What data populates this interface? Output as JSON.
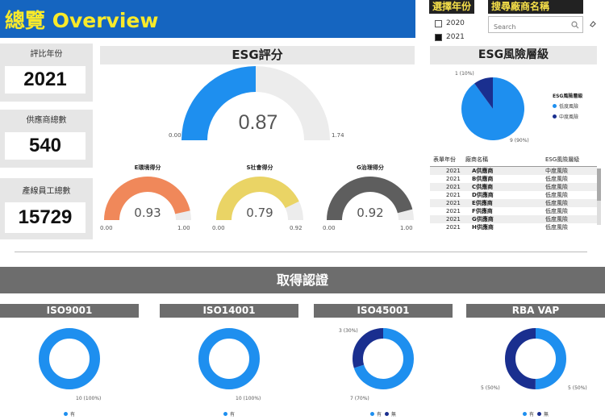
{
  "header": {
    "title": "總覽 Overview"
  },
  "filters": {
    "year_title": "選擇年份",
    "years": [
      {
        "label": "2020",
        "checked": false
      },
      {
        "label": "2021",
        "checked": true
      }
    ],
    "search_title": "搜尋廠商名稱",
    "search_placeholder": "Search"
  },
  "kpis": {
    "year": {
      "label": "評比年份",
      "value": "2021"
    },
    "suppliers": {
      "label": "供應商總數",
      "value": "540"
    },
    "employees": {
      "label": "產線員工總數",
      "value": "15729"
    }
  },
  "esg": {
    "title": "ESG評分",
    "score": "0.87",
    "min": "0.00",
    "max": "1.74",
    "value": 0.87,
    "range": [
      0,
      1.74
    ]
  },
  "sub_scores": [
    {
      "label": "E環境得分",
      "score": "0.93",
      "min": "0.00",
      "max": "1.00",
      "value": 0.93,
      "color": "#f0885a"
    },
    {
      "label": "S社會得分",
      "score": "0.79",
      "min": "0.00",
      "max": "0.92",
      "value": 0.79,
      "range_max": 0.92,
      "color": "#ead465"
    },
    {
      "label": "G治理得分",
      "score": "0.92",
      "min": "0.00",
      "max": "1.00",
      "value": 0.92,
      "color": "#5e5e5e"
    }
  ],
  "risk": {
    "title": "ESG風險層級",
    "legend_title": "ESG風險層級",
    "slices": [
      {
        "name": "低度風險",
        "value": 9,
        "label": "9 (90%)",
        "color": "#1e8fef"
      },
      {
        "name": "中度風險",
        "value": 1,
        "label": "1 (10%)",
        "color": "#1a2f8f"
      }
    ],
    "table": {
      "columns": [
        "表單年份",
        "廠商名稱",
        "ESG風險層級"
      ],
      "rows": [
        [
          "2021",
          "A供應商",
          "中度風險"
        ],
        [
          "2021",
          "B供應商",
          "低度風險"
        ],
        [
          "2021",
          "C供應商",
          "低度風險"
        ],
        [
          "2021",
          "D供應商",
          "低度風險"
        ],
        [
          "2021",
          "E供應商",
          "低度風險"
        ],
        [
          "2021",
          "F供應商",
          "低度風險"
        ],
        [
          "2021",
          "G供應商",
          "低度風險"
        ],
        [
          "2021",
          "H供應商",
          "低度風險"
        ]
      ]
    }
  },
  "certifications": {
    "title": "取得認證",
    "yes_label": "有",
    "no_label": "無",
    "colors": {
      "yes": "#1e8fef",
      "no": "#1a2f8f"
    },
    "items": [
      {
        "name": "ISO9001",
        "yes": 10,
        "no": 0,
        "yes_label": "10 (100%)",
        "no_label": ""
      },
      {
        "name": "ISO14001",
        "yes": 10,
        "no": 0,
        "yes_label": "10 (100%)",
        "no_label": ""
      },
      {
        "name": "ISO45001",
        "yes": 7,
        "no": 3,
        "yes_label": "7 (70%)",
        "no_label": "3 (30%)"
      },
      {
        "name": "RBA VAP",
        "yes": 5,
        "no": 5,
        "yes_label": "5 (50%)",
        "no_label": "5 (50%)"
      }
    ]
  }
}
